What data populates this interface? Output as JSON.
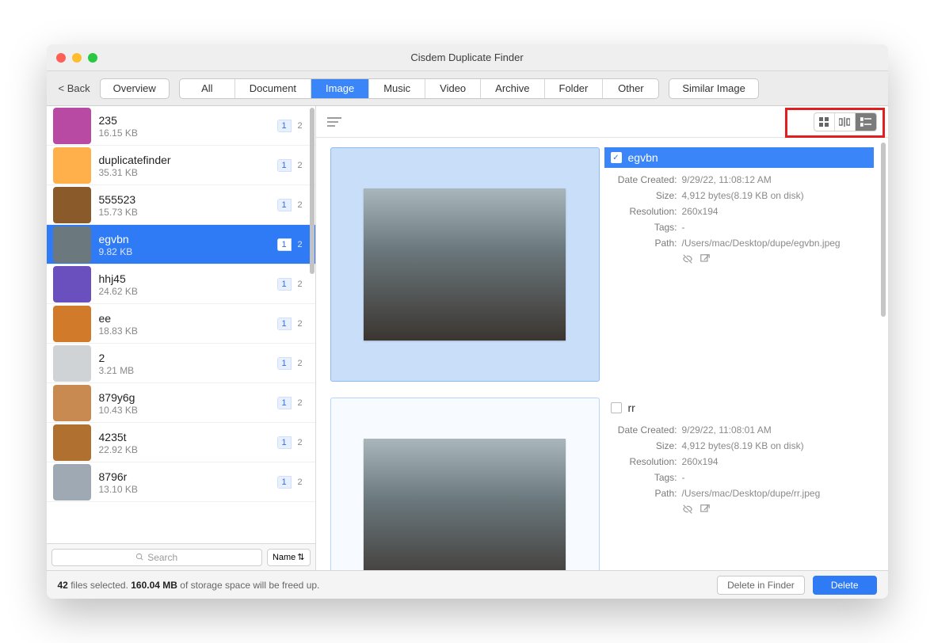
{
  "window": {
    "title": "Cisdem Duplicate Finder"
  },
  "toolbar": {
    "back": "< Back",
    "overview": "Overview",
    "tabs": [
      "All",
      "Document",
      "Image",
      "Music",
      "Video",
      "Archive",
      "Folder",
      "Other"
    ],
    "active_tab_index": 2,
    "similar": "Similar Image"
  },
  "sidebar": {
    "items": [
      {
        "name": "235",
        "size": "16.15 KB",
        "c1": "1",
        "c2": "2",
        "thumb": "#b94aa3"
      },
      {
        "name": "duplicatefinder",
        "size": "35.31 KB",
        "c1": "1",
        "c2": "2",
        "thumb": "#ffb04a"
      },
      {
        "name": "555523",
        "size": "15.73 KB",
        "c1": "1",
        "c2": "2",
        "thumb": "#8b5a2b"
      },
      {
        "name": "egvbn",
        "size": "9.82 KB",
        "c1": "1",
        "c2": "2",
        "thumb": "#6b787d",
        "selected": true
      },
      {
        "name": "hhj45",
        "size": "24.62 KB",
        "c1": "1",
        "c2": "2",
        "thumb": "#6a4fbf"
      },
      {
        "name": "ee",
        "size": "18.83 KB",
        "c1": "1",
        "c2": "2",
        "thumb": "#d07a2a"
      },
      {
        "name": "2",
        "size": "3.21 MB",
        "c1": "1",
        "c2": "2",
        "thumb": "#cfd3d6"
      },
      {
        "name": "879y6g",
        "size": "10.43 KB",
        "c1": "1",
        "c2": "2",
        "thumb": "#c98a52"
      },
      {
        "name": "4235t",
        "size": "22.92 KB",
        "c1": "1",
        "c2": "2",
        "thumb": "#b07030"
      },
      {
        "name": "8796r",
        "size": "13.10 KB",
        "c1": "1",
        "c2": "2",
        "thumb": "#9fa9b3"
      }
    ],
    "search_placeholder": "Search",
    "sort_label": "Name"
  },
  "details": [
    {
      "checked": true,
      "title": "egvbn",
      "date_created": "9/29/22, 11:08:12 AM",
      "size": "4,912 bytes(8.19 KB on disk)",
      "resolution": "260x194",
      "tags": "-",
      "path": "/Users/mac/Desktop/dupe/egvbn.jpeg"
    },
    {
      "checked": false,
      "title": "rr",
      "date_created": "9/29/22, 11:08:01 AM",
      "size": "4,912 bytes(8.19 KB on disk)",
      "resolution": "260x194",
      "tags": "-",
      "path": "/Users/mac/Desktop/dupe/rr.jpeg"
    }
  ],
  "labels": {
    "date_created": "Date Created:",
    "size": "Size:",
    "resolution": "Resolution:",
    "tags": "Tags:",
    "path": "Path:"
  },
  "footer": {
    "count": "42",
    "t1": " files selected. ",
    "mb": "160.04 MB",
    "t2": " of storage space will be freed up.",
    "delete_finder": "Delete in Finder",
    "delete": "Delete"
  }
}
